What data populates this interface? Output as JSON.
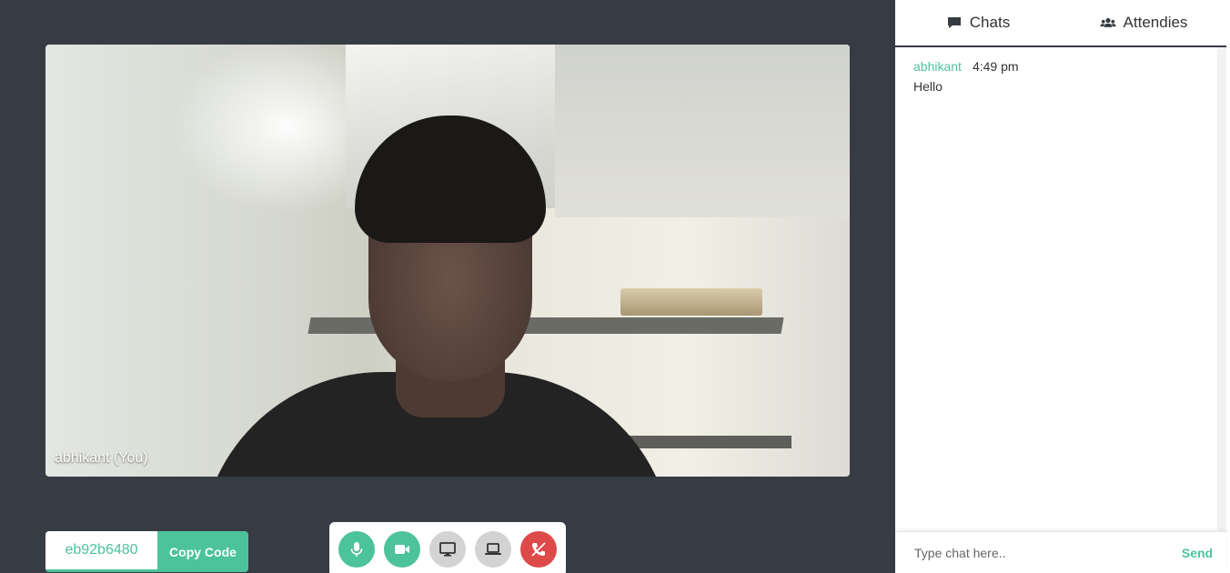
{
  "video": {
    "participant_label": "abhikant (You)"
  },
  "meeting": {
    "code": "eb92b6480",
    "copy_label": "Copy Code"
  },
  "controls": [
    {
      "name": "microphone",
      "icon": "microphone-icon",
      "state": "on",
      "color": "#4cc39a"
    },
    {
      "name": "camera",
      "icon": "video-camera-icon",
      "state": "on",
      "color": "#4cc39a"
    },
    {
      "name": "screen-share",
      "icon": "desktop-icon",
      "state": "off",
      "color": "#d3d3d3"
    },
    {
      "name": "whiteboard",
      "icon": "laptop-icon",
      "state": "off",
      "color": "#d3d3d3"
    },
    {
      "name": "end-call",
      "icon": "phone-slash-icon",
      "state": "active",
      "color": "#de4a4a"
    }
  ],
  "sidebar": {
    "tabs": [
      {
        "label": "Chats",
        "icon": "comment-icon",
        "active": true
      },
      {
        "label": "Attendies",
        "icon": "users-icon",
        "active": false
      }
    ],
    "messages": [
      {
        "user": "abhikant",
        "time": "4:49 pm",
        "text": "Hello"
      }
    ],
    "composer": {
      "placeholder": "Type chat here..",
      "send_label": "Send"
    }
  },
  "colors": {
    "accent": "#4cc39a",
    "background": "#373b44",
    "danger": "#de4a4a"
  }
}
